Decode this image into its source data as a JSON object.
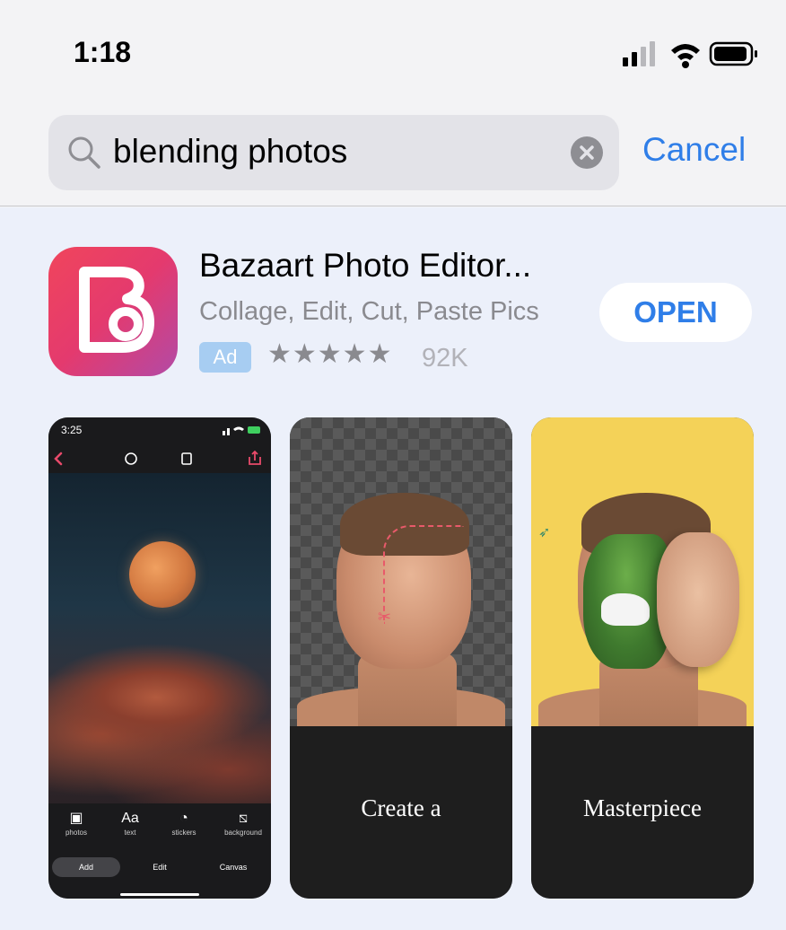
{
  "status_bar": {
    "time": "1:18",
    "icons": [
      "cellular-signal-icon",
      "wifi-icon",
      "battery-icon"
    ]
  },
  "search": {
    "query": "blending photos",
    "cancel_label": "Cancel",
    "icons": [
      "search-icon",
      "clear-icon"
    ]
  },
  "result": {
    "title": "Bazaart Photo Editor...",
    "subtitle": "Collage, Edit, Cut, Paste Pics",
    "ad_label": "Ad",
    "stars": "★★★★★",
    "rating_value": 5,
    "rating_count": "92K",
    "open_label": "OPEN",
    "colors": {
      "accent": "#2f7ee8",
      "icon_gradient": [
        "#f0455c",
        "#b24aa6"
      ]
    }
  },
  "screenshots": {
    "shot1": {
      "time": "3:25",
      "tools": [
        {
          "label": "photos",
          "icon": "image-icon"
        },
        {
          "label": "text",
          "glyph": "Aa"
        },
        {
          "label": "stickers",
          "icon": "sticker-icon"
        },
        {
          "label": "background",
          "icon": "background-icon"
        }
      ],
      "modes": [
        "Add",
        "Edit",
        "Canvas"
      ],
      "active_mode": "Add"
    },
    "shot2": {
      "caption": "Create a"
    },
    "shot3": {
      "caption": "Masterpiece"
    }
  }
}
